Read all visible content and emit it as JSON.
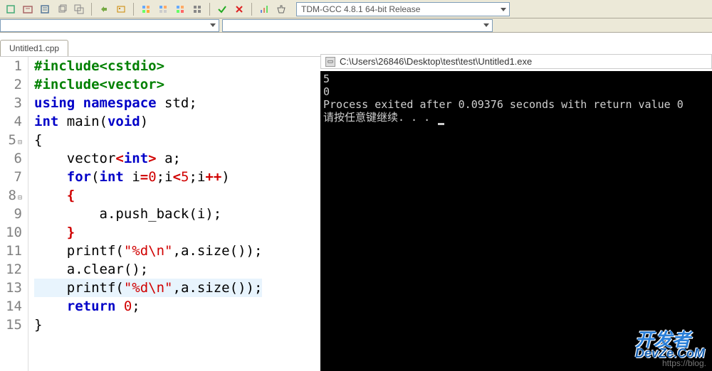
{
  "toolbar": {
    "compiler": "TDM-GCC 4.8.1 64-bit Release"
  },
  "tab": {
    "label": "Untitled1.cpp"
  },
  "editor": {
    "highlight_line": 13,
    "lines": [
      {
        "num": 1,
        "fold": "",
        "tokens": [
          [
            "pre",
            "#include"
          ],
          [
            "pre",
            "<cstdio>"
          ]
        ]
      },
      {
        "num": 2,
        "fold": "",
        "tokens": [
          [
            "pre",
            "#include"
          ],
          [
            "pre",
            "<vector>"
          ]
        ]
      },
      {
        "num": 3,
        "fold": "",
        "tokens": [
          [
            "kw",
            "using "
          ],
          [
            "kw",
            "namespace "
          ],
          [
            "id",
            "std"
          ],
          [
            "punct",
            ";"
          ]
        ]
      },
      {
        "num": 4,
        "fold": "",
        "tokens": [
          [
            "kw",
            "int "
          ],
          [
            "id",
            "main"
          ],
          [
            "punct",
            "("
          ],
          [
            "kw",
            "void"
          ],
          [
            "punct",
            ")"
          ]
        ]
      },
      {
        "num": 5,
        "fold": "⊟",
        "tokens": [
          [
            "punct",
            "{"
          ]
        ]
      },
      {
        "num": 6,
        "fold": "",
        "tokens": [
          [
            "id",
            "    vector"
          ],
          [
            "op",
            "<"
          ],
          [
            "kw",
            "int"
          ],
          [
            "op",
            ">"
          ],
          [
            "id",
            " a"
          ],
          [
            "punct",
            ";"
          ]
        ]
      },
      {
        "num": 7,
        "fold": "",
        "tokens": [
          [
            "id",
            "    "
          ],
          [
            "kw",
            "for"
          ],
          [
            "punct",
            "("
          ],
          [
            "kw",
            "int "
          ],
          [
            "id",
            "i"
          ],
          [
            "op",
            "="
          ],
          [
            "num",
            "0"
          ],
          [
            "punct",
            ";"
          ],
          [
            "id",
            "i"
          ],
          [
            "op",
            "<"
          ],
          [
            "num",
            "5"
          ],
          [
            "punct",
            ";"
          ],
          [
            "id",
            "i"
          ],
          [
            "op",
            "++"
          ],
          [
            "punct",
            ")"
          ]
        ]
      },
      {
        "num": 8,
        "fold": "⊟",
        "tokens": [
          [
            "id",
            "    "
          ],
          [
            "op",
            "{"
          ]
        ]
      },
      {
        "num": 9,
        "fold": "",
        "tokens": [
          [
            "id",
            "        a"
          ],
          [
            "punct",
            "."
          ],
          [
            "id",
            "push_back"
          ],
          [
            "punct",
            "("
          ],
          [
            "id",
            "i"
          ],
          [
            "punct",
            ")"
          ],
          [
            "punct",
            ";"
          ]
        ]
      },
      {
        "num": 10,
        "fold": "",
        "tokens": [
          [
            "id",
            "    "
          ],
          [
            "op",
            "}"
          ]
        ]
      },
      {
        "num": 11,
        "fold": "",
        "tokens": [
          [
            "id",
            "    printf"
          ],
          [
            "punct",
            "("
          ],
          [
            "str",
            "\"%d\\n\""
          ],
          [
            "punct",
            ","
          ],
          [
            "id",
            "a"
          ],
          [
            "punct",
            "."
          ],
          [
            "id",
            "size"
          ],
          [
            "punct",
            "("
          ],
          [
            "punct",
            ")"
          ],
          [
            "punct",
            ")"
          ],
          [
            "punct",
            ";"
          ]
        ]
      },
      {
        "num": 12,
        "fold": "",
        "tokens": [
          [
            "id",
            "    a"
          ],
          [
            "punct",
            "."
          ],
          [
            "id",
            "clear"
          ],
          [
            "punct",
            "("
          ],
          [
            "punct",
            ")"
          ],
          [
            "punct",
            ";"
          ]
        ]
      },
      {
        "num": 13,
        "fold": "",
        "tokens": [
          [
            "id",
            "    printf"
          ],
          [
            "punct",
            "("
          ],
          [
            "str",
            "\"%d\\n\""
          ],
          [
            "punct",
            ","
          ],
          [
            "id",
            "a"
          ],
          [
            "punct",
            "."
          ],
          [
            "id",
            "size"
          ],
          [
            "punct",
            "("
          ],
          [
            "punct",
            ")"
          ],
          [
            "punct",
            ")"
          ],
          [
            "punct",
            ";"
          ]
        ]
      },
      {
        "num": 14,
        "fold": "",
        "tokens": [
          [
            "id",
            "    "
          ],
          [
            "kw",
            "return "
          ],
          [
            "num",
            "0"
          ],
          [
            "punct",
            ";"
          ]
        ]
      },
      {
        "num": 15,
        "fold": "",
        "tokens": [
          [
            "punct",
            "}"
          ]
        ]
      }
    ]
  },
  "console": {
    "title_path": "C:\\Users\\26846\\Desktop\\test\\test\\Untitled1.exe",
    "lines": [
      "5",
      "0",
      "",
      "Process exited after 0.09376 seconds with return value 0",
      "请按任意键继续. . . "
    ]
  },
  "watermark": {
    "url": "https://blog.",
    "brand1": "开发者",
    "brand2": "DevZe.CoM"
  }
}
